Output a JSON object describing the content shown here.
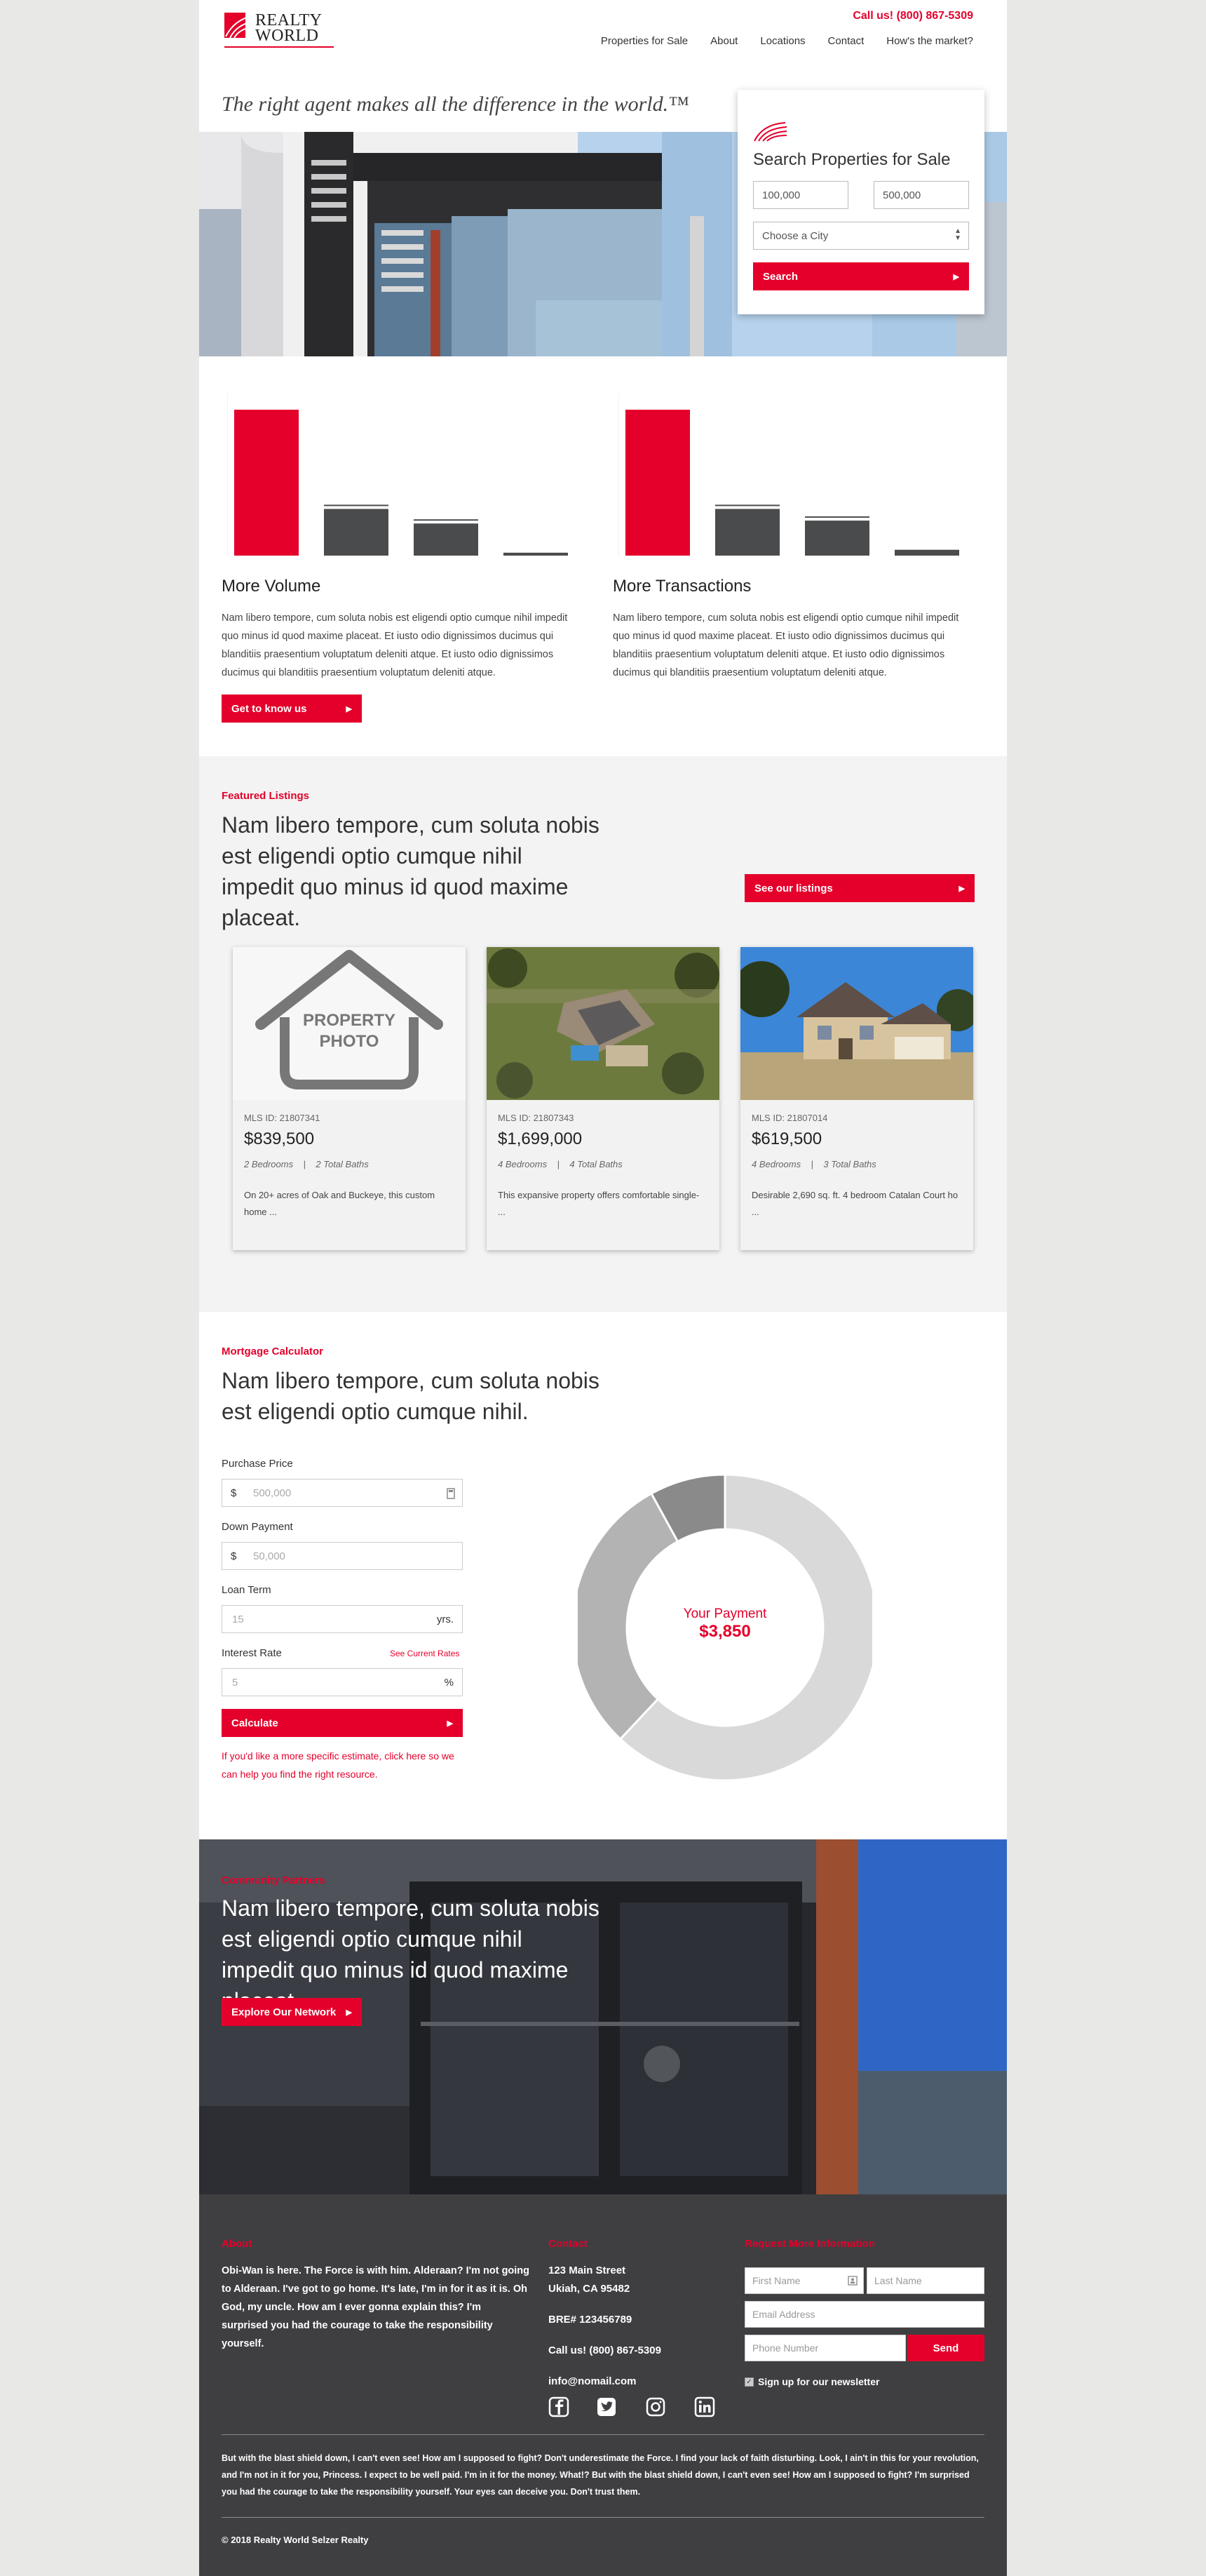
{
  "header": {
    "logo_text_1": "REALTY",
    "logo_text_2": "WORLD",
    "call": "Call us! (800) 867-5309",
    "nav": [
      "Properties for Sale",
      "About",
      "Locations",
      "Contact",
      "How's the market?"
    ]
  },
  "hero": {
    "tagline": "The right agent makes all the difference in the world.™",
    "search": {
      "title": "Search Properties for Sale",
      "min_price": "100,000",
      "max_price": "500,000",
      "city_placeholder": "Choose a City",
      "button": "Search"
    }
  },
  "stats": {
    "volume": {
      "title": "More Volume",
      "text": "Nam libero tempore, cum soluta nobis est eligendi optio cumque nihil impedit quo minus id quod maxime placeat. Et iusto odio dignissimos ducimus qui blanditiis praesentium voluptatum deleniti atque. Et iusto odio dignissimos ducimus qui blanditiis praesentium voluptatum deleniti atque.",
      "button": "Get to know us",
      "bars": [
        100,
        32,
        22,
        2
      ]
    },
    "transactions": {
      "title": "More Transactions",
      "text": "Nam libero tempore, cum soluta nobis est eligendi optio cumque nihil impedit quo minus id quod maxime placeat. Et iusto odio dignissimos ducimus qui blanditiis praesentium voluptatum deleniti atque. Et iusto odio dignissimos ducimus qui blanditiis praesentium voluptatum deleniti atque.",
      "bars": [
        100,
        32,
        24,
        4
      ]
    },
    "colors": {
      "highlight": "#e4002b",
      "other": "#4a4b4d"
    }
  },
  "featured": {
    "kicker": "Featured Listings",
    "headline": "Nam libero tempore, cum soluta nobis est eligendi optio cumque nihil impedit quo minus id quod maxime placeat.",
    "button": "See our listings",
    "placeholder_line1": "PROPERTY",
    "placeholder_line2": "PHOTO",
    "listings": [
      {
        "mls": "MLS ID: 21807341",
        "price": "$839,500",
        "beds": "2 Bedrooms",
        "baths": "2 Total Baths",
        "desc": "On 20+ acres of Oak and Buckeye, this custom home ..."
      },
      {
        "mls": "MLS ID: 21807343",
        "price": "$1,699,000",
        "beds": "4 Bedrooms",
        "baths": "4 Total Baths",
        "desc": "This expansive property offers comfortable single- ..."
      },
      {
        "mls": "MLS ID: 21807014",
        "price": "$619,500",
        "beds": "4 Bedrooms",
        "baths": "3 Total Baths",
        "desc": "Desirable 2,690 sq. ft. 4 bedroom Catalan Court ho ..."
      }
    ]
  },
  "mortgage": {
    "kicker": "Mortgage Calculator",
    "headline": "Nam libero tempore, cum soluta nobis est eligendi optio cumque nihil.",
    "purchase_label": "Purchase Price",
    "purchase_prefix": "$",
    "purchase_placeholder": "500,000",
    "down_label": "Down Payment",
    "down_prefix": "$",
    "down_placeholder": "50,000",
    "term_label": "Loan Term",
    "term_placeholder": "15",
    "term_suffix": "yrs.",
    "rate_label": "Interest Rate",
    "rate_link": "See Current Rates",
    "rate_placeholder": "5",
    "rate_suffix": "%",
    "button": "Calculate",
    "note": "If you'd like a more specific estimate, click here so we can help you find the right resource.",
    "donut": {
      "center_label": "Your Payment",
      "center_value": "$3,850",
      "segments": [
        {
          "value": 62,
          "color": "#d9d9d9"
        },
        {
          "value": 30,
          "color": "#b3b3b3"
        },
        {
          "value": 8,
          "color": "#8a8a8a"
        }
      ]
    }
  },
  "partners": {
    "kicker": "Community Partners",
    "headline": "Nam libero tempore, cum soluta nobis est eligendi optio cumque nihil impedit quo minus id quod maxime placeat.",
    "button": "Explore Our Network"
  },
  "footer": {
    "about_title": "About",
    "about_text": "Obi-Wan is here. The Force is with him. Alderaan? I'm not going to Alderaan. I've got to go home. It's late, I'm in for it as it is. Oh God, my uncle. How am I ever gonna explain this? I'm surprised you had the courage to take the responsibility yourself.",
    "contact_title": "Contact",
    "address_1": "123 Main Street",
    "address_2": "Ukiah, CA 95482",
    "bre": "BRE# 123456789",
    "call": "Call us! (800) 867-5309",
    "email": "info@nomail.com",
    "request_title": "Request More Information",
    "first_name": "First Name",
    "last_name": "Last Name",
    "email_placeholder": "Email Address",
    "phone_placeholder": "Phone Number",
    "send": "Send",
    "newsletter": "Sign up for our newsletter",
    "disclaimer": "But with the blast shield down, I can't even see! How am I supposed to fight? Don't underestimate the Force. I find your lack of faith disturbing. Look, I ain't in this for your revolution, and I'm not in it for you, Princess. I expect to be well paid. I'm in it for the money. What!? But with the blast shield down, I can't even see! How am I supposed to fight? I'm surprised you had the courage to take the responsibility yourself. Your eyes can deceive you. Don't trust them.",
    "copyright": "© 2018 Realty World Selzer Realty"
  }
}
